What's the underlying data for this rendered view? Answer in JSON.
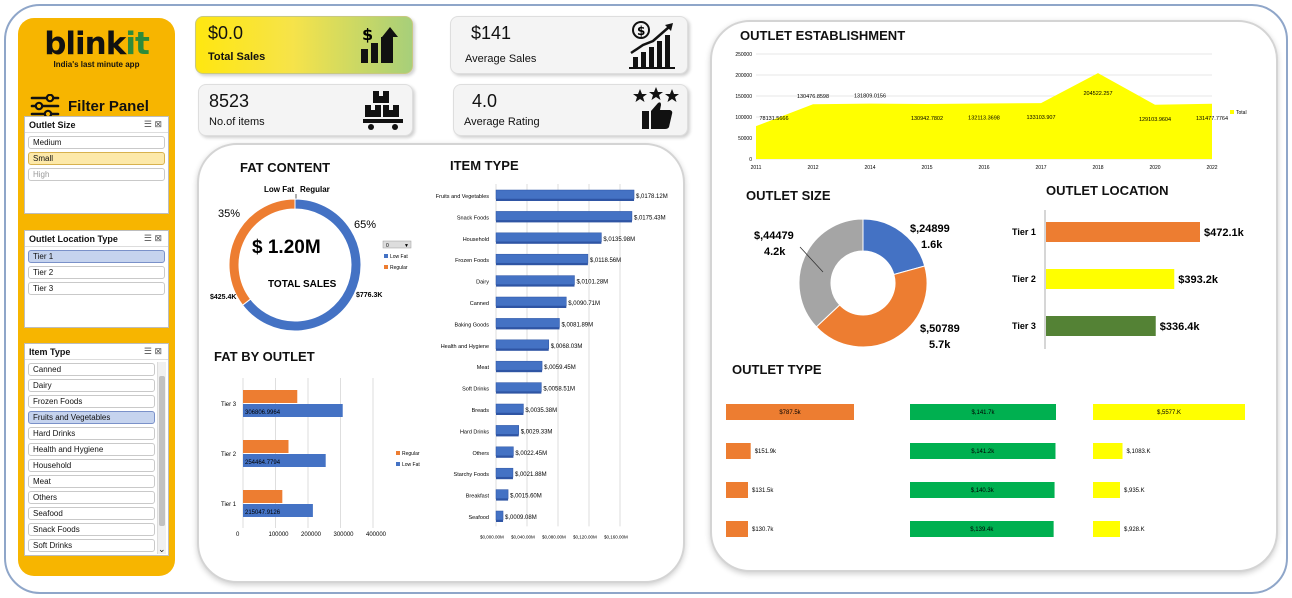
{
  "brand": {
    "logo_left": "blink",
    "logo_right": "it",
    "tagline": "India's last minute app",
    "filter_panel": "Filter Panel"
  },
  "slicers": {
    "outlet_size": {
      "title": "Outlet Size",
      "items": [
        "Medium",
        "Small",
        "High"
      ]
    },
    "outlet_location": {
      "title": "Outlet Location Type",
      "items": [
        "Tier 1",
        "Tier 2",
        "Tier 3"
      ]
    },
    "item_type": {
      "title": "Item Type",
      "items": [
        "Canned",
        "Dairy",
        "Frozen Foods",
        "Fruits and Vegetables",
        "Hard Drinks",
        "Health and Hygiene",
        "Household",
        "Meat",
        "Others",
        "Seafood",
        "Snack Foods",
        "Soft Drinks"
      ]
    }
  },
  "kpis": {
    "total_sales": {
      "value": "$0.0",
      "label": "Total Sales"
    },
    "average_sales": {
      "value": "$141",
      "label": "Average Sales"
    },
    "items": {
      "value": "8523",
      "label": "No.of items"
    },
    "rating": {
      "value": "4.0",
      "label": "Average Rating"
    }
  },
  "fat_content": {
    "title": "FAT CONTENT",
    "center_value": "$ 1.20M",
    "center_label": "TOTAL SALES",
    "top_labels": [
      "Low Fat",
      "Regular"
    ],
    "pct_regular": "35%",
    "pct_lowfat": "65%",
    "val_regular": "$425.4K",
    "val_lowfat": "$776.3K",
    "filter_value": "0",
    "legend": [
      "Low Fat",
      "Regular"
    ]
  },
  "fat_by_outlet": {
    "title": "FAT BY OUTLET",
    "legend": [
      "Regular",
      "Low Fat"
    ],
    "x_ticks": [
      "0",
      "100000",
      "200000",
      "300000",
      "400000"
    ]
  },
  "item_type": {
    "title": "ITEM TYPE",
    "x_ticks": [
      "$0,000.00M",
      "$0,040.00M",
      "$0,080.00M",
      "$0,120.00M",
      "$0,160.00M"
    ]
  },
  "outlet_establishment": {
    "title": "OUTLET ESTABLISHMENT",
    "legend": "Total"
  },
  "outlet_size": {
    "title": "OUTLET SIZE",
    "labels": [
      {
        "value": "$,24899",
        "count": "1.6k"
      },
      {
        "value": "$,50789",
        "count": "5.7k"
      },
      {
        "value": "$,44479",
        "count": "4.2k"
      }
    ]
  },
  "outlet_location": {
    "title": "OUTLET LOCATION"
  },
  "outlet_type": {
    "title": "OUTLET  TYPE"
  },
  "chart_data": [
    {
      "type": "pie",
      "name": "FAT CONTENT",
      "categories": [
        "Low Fat",
        "Regular"
      ],
      "values": [
        776.3,
        425.4
      ],
      "unit": "$K",
      "colors": [
        "#4472c4",
        "#ed7d31"
      ]
    },
    {
      "type": "bar",
      "name": "FAT BY OUTLET",
      "orientation": "horizontal",
      "categories": [
        "Tier 1",
        "Tier 2",
        "Tier 3"
      ],
      "series": [
        {
          "name": "Regular",
          "values": [
            121000,
            140000,
            167000
          ],
          "color": "#ed7d31"
        },
        {
          "name": "Low Fat",
          "values": [
            215047.9126,
            254464.7794,
            306806.9964
          ],
          "labels": [
            "215047.9126",
            "254464.7794",
            "306806.9964"
          ],
          "color": "#4472c4"
        }
      ],
      "xlim": [
        0,
        400000
      ]
    },
    {
      "type": "bar",
      "name": "ITEM TYPE",
      "orientation": "horizontal",
      "categories": [
        "Fruits and Vegetables",
        "Snack Foods",
        "Household",
        "Frozen Foods",
        "Dairy",
        "Canned",
        "Baking Goods",
        "Health and Hygiene",
        "Meat",
        "Soft Drinks",
        "Breads",
        "Hard Drinks",
        "Others",
        "Starchy Foods",
        "Breakfast",
        "Seafood"
      ],
      "values": [
        178.12,
        175.43,
        135.98,
        118.56,
        101.28,
        90.71,
        81.89,
        68.03,
        59.45,
        58.51,
        35.38,
        29.33,
        22.45,
        21.88,
        15.6,
        9.08
      ],
      "labels": [
        "$,0178.12M",
        "$,0175.43M",
        "$,0135.98M",
        "$,0118.56M",
        "$,0101.28M",
        "$,0090.71M",
        "$,0081.89M",
        "$,0068.03M",
        "$,0059.45M",
        "$,0058.51M",
        "$,0035.38M",
        "$,0029.33M",
        "$,0022.45M",
        "$,0021.88M",
        "$,0015.60M",
        "$,0009.08M"
      ],
      "xlim": [
        0,
        160
      ],
      "color": "#4472c4"
    },
    {
      "type": "area",
      "name": "OUTLET ESTABLISHMENT",
      "x": [
        "2011",
        "2012",
        "2014",
        "2015",
        "2016",
        "2017",
        "2018",
        "2020",
        "2022"
      ],
      "y": [
        78131.5666,
        130476.8598,
        131809.0156,
        130942.7802,
        132113.3698,
        133103.907,
        204522.257,
        129103.9604,
        131477.7764
      ],
      "labels": [
        "78131.5666",
        "130476.8598",
        "131809.0156",
        "130942.7802",
        "132113.3698",
        "133103.907",
        "204522.257",
        "129103.9604",
        "131477.7764"
      ],
      "y_ticks": [
        "0",
        "50000",
        "100000",
        "150000",
        "200000",
        "250000"
      ],
      "ylim": [
        0,
        250000
      ],
      "color": "#ffff00"
    },
    {
      "type": "pie",
      "name": "OUTLET SIZE",
      "categories": [
        "High",
        "Medium",
        "Small"
      ],
      "values": [
        24899,
        50789,
        44479
      ],
      "colors": [
        "#4472c4",
        "#ed7d31",
        "#a5a5a5"
      ]
    },
    {
      "type": "bar",
      "name": "OUTLET LOCATION",
      "orientation": "horizontal",
      "categories": [
        "Tier 1",
        "Tier 2",
        "Tier 3"
      ],
      "values": [
        472.1,
        393.2,
        336.4
      ],
      "labels": [
        "$472.1k",
        "$393.2k",
        "$336.4k"
      ],
      "colors": [
        "#ed7d31",
        "#ffff00",
        "#548235"
      ]
    },
    {
      "type": "bar",
      "name": "OUTLET  TYPE",
      "orientation": "horizontal",
      "groups": [
        {
          "color": "#ed7d31",
          "values": [
            787.5,
            151.9,
            131.5,
            130.7
          ],
          "labels": [
            "$787.5k",
            "$151.9k",
            "$131.5k",
            "$130.7k"
          ]
        },
        {
          "color": "#00b050",
          "values": [
            141.7,
            141.2,
            140.3,
            139.4
          ],
          "labels": [
            "$,141.7k",
            "$,141.2k",
            "$,140.3k",
            "$,139.4k"
          ]
        },
        {
          "color": "#ffff00",
          "values": [
            5577,
            1083,
            935,
            928
          ],
          "labels": [
            "$,5577.K",
            "$,1083.K",
            "$,935.K",
            "$,928.K"
          ]
        }
      ]
    }
  ]
}
